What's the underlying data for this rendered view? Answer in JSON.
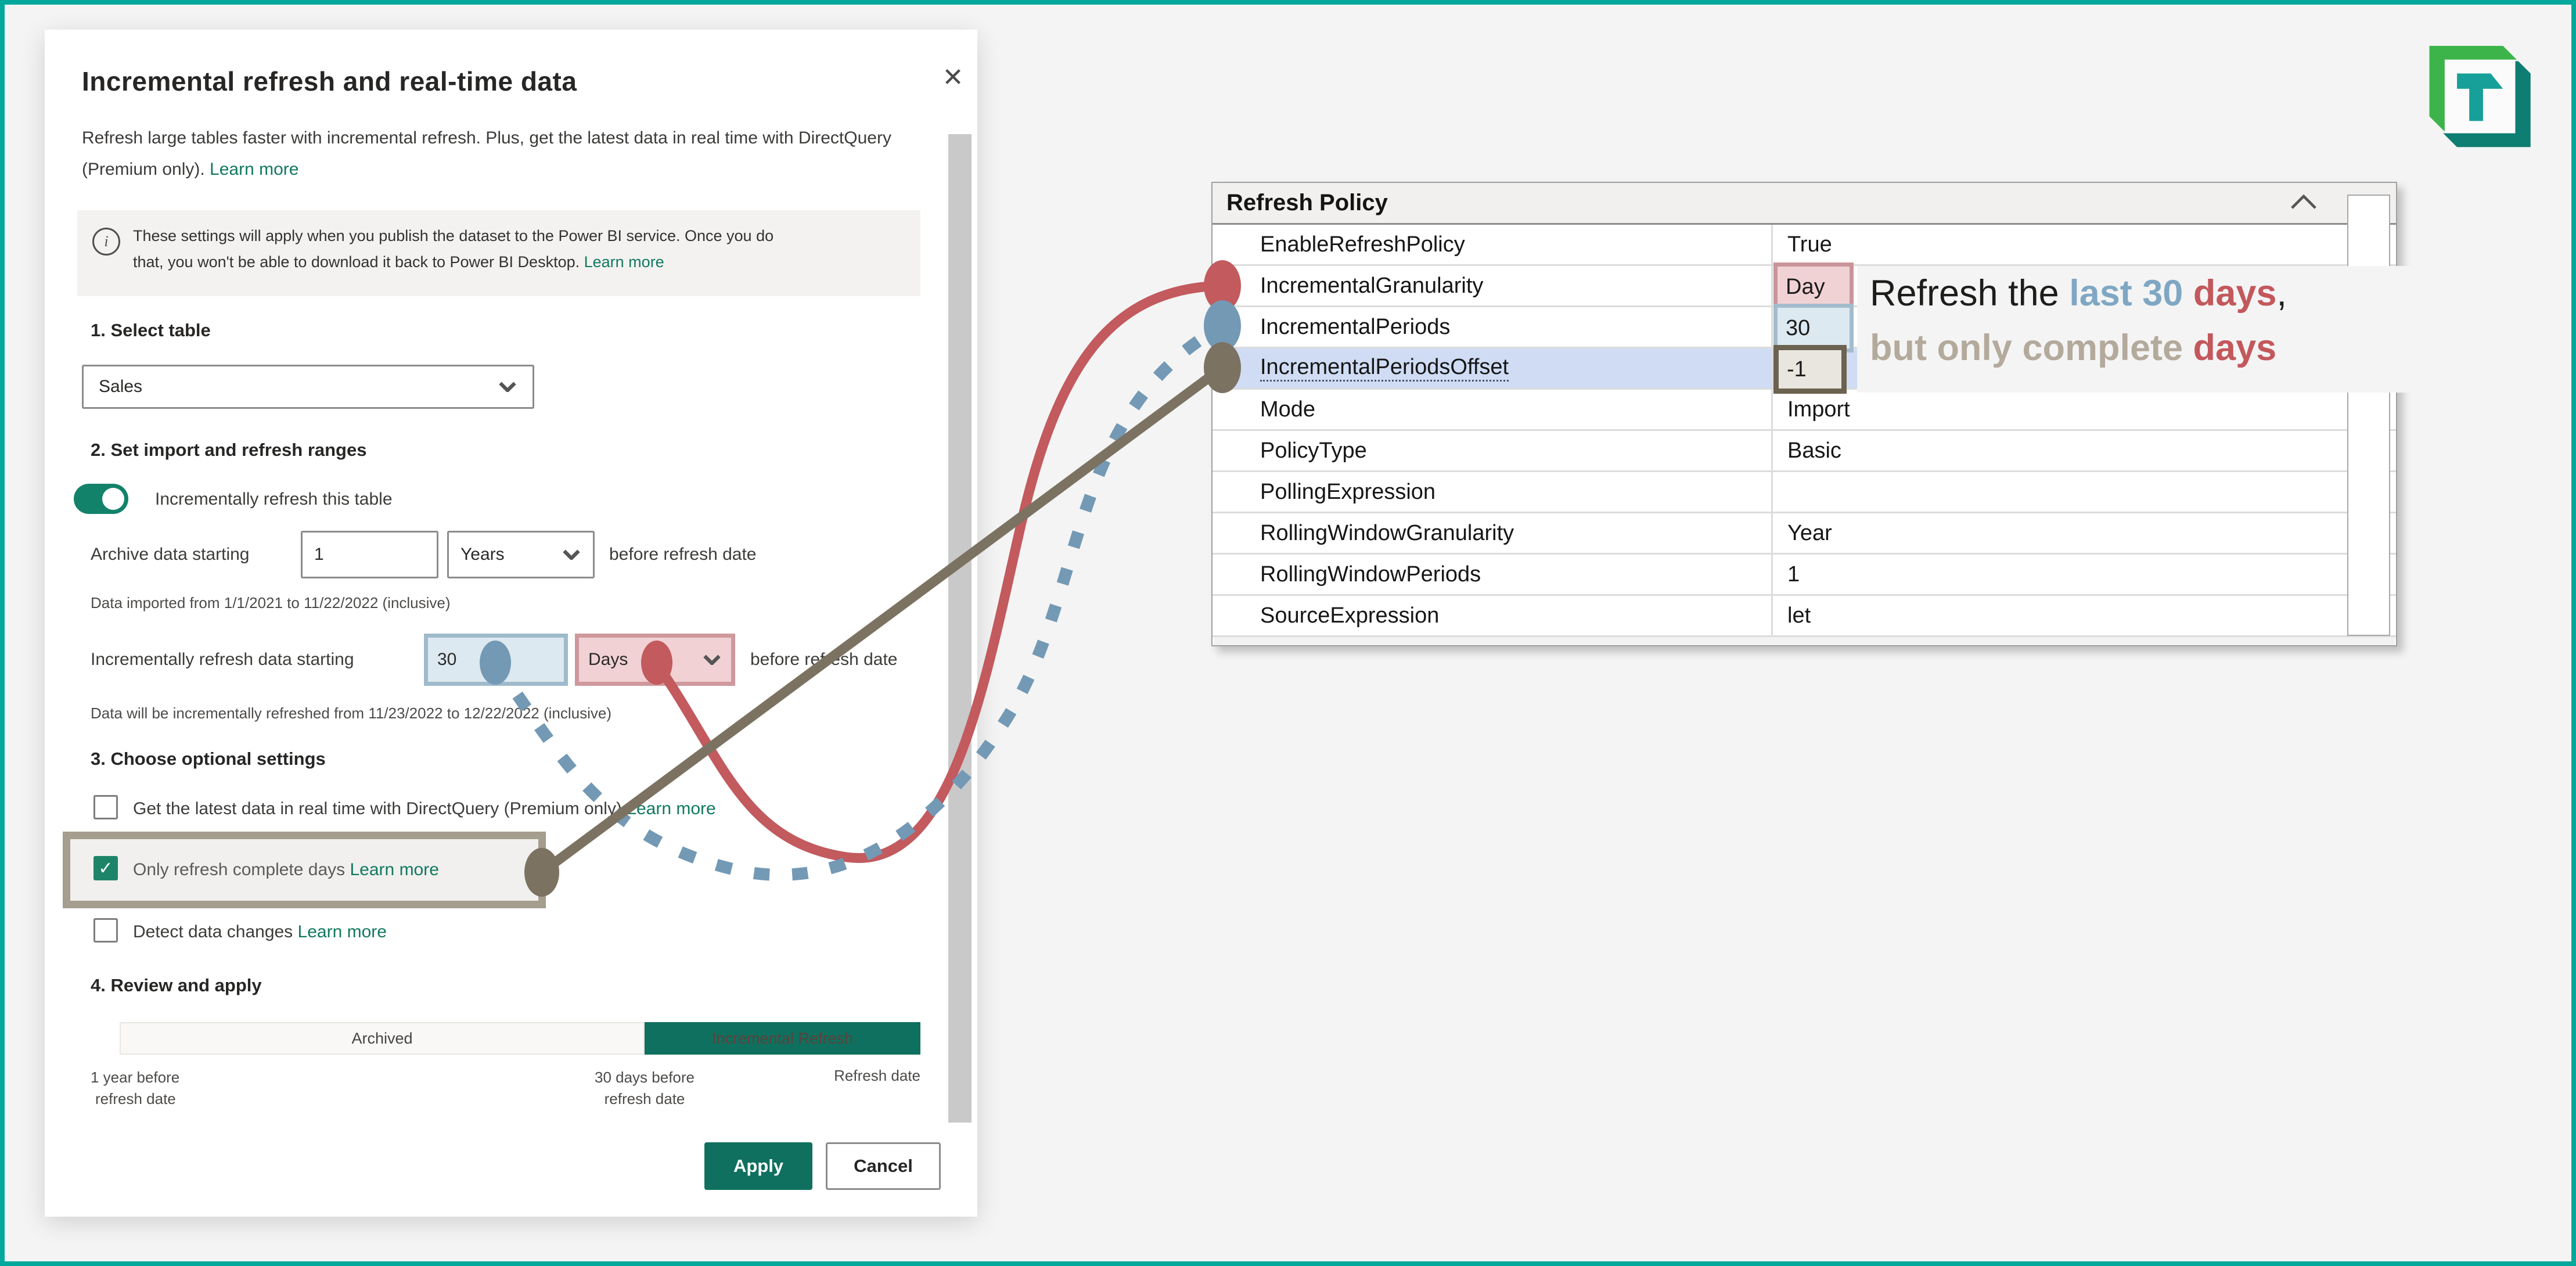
{
  "dialog": {
    "title": "Incremental refresh and real-time data",
    "description": "Refresh large tables faster with incremental refresh. Plus, get the latest data in real time with DirectQuery (Premium only).",
    "description_link": "Learn more",
    "info_line1": "These settings will apply when you publish the dataset to the Power BI service. Once you do",
    "info_line2": "that, you won't be able to download it back to Power BI Desktop.",
    "info_link": "Learn more",
    "info_icon_glyph": "i",
    "section1": "1. Select table",
    "section2": "2. Set import and refresh ranges",
    "section3": "3. Choose optional settings",
    "section4": "4. Review and apply",
    "table_select_value": "Sales",
    "toggle_label": "Incrementally refresh this table",
    "archive_label": "Archive data starting",
    "archive_value": "1",
    "archive_unit": "Years",
    "archive_suffix": "before refresh date",
    "import_note": "Data imported from 1/1/2021 to 11/22/2022 (inclusive)",
    "incremental_label": "Incrementally refresh data starting",
    "incremental_value": "30",
    "incremental_unit": "Days",
    "incremental_suffix": "before refresh date",
    "refresh_note": "Data will be incrementally refreshed from 11/23/2022 to 12/22/2022 (inclusive)",
    "options": [
      {
        "label": "Get the latest data in real time with DirectQuery (Premium only)",
        "link": "Learn more"
      },
      {
        "label": "Only refresh complete days",
        "link": "Learn more"
      },
      {
        "label": "Detect data changes",
        "link": "Learn more"
      }
    ],
    "review": {
      "archived_label": "Archived",
      "incremental_label": "Incremental Refresh",
      "left_line1": "1 year before",
      "left_line2": "refresh date",
      "mid_line1": "30 days before",
      "mid_line2": "refresh date",
      "right_label": "Refresh date"
    },
    "apply_label": "Apply",
    "cancel_label": "Cancel",
    "close_glyph": "✕"
  },
  "property_grid": {
    "title": "Refresh Policy",
    "rows": [
      {
        "name": "EnableRefreshPolicy",
        "value": "True"
      },
      {
        "name": "IncrementalGranularity",
        "value": "Day"
      },
      {
        "name": "IncrementalPeriods",
        "value": "30"
      },
      {
        "name": "IncrementalPeriodsOffset",
        "value": "-1"
      },
      {
        "name": "Mode",
        "value": "Import"
      },
      {
        "name": "PolicyType",
        "value": "Basic"
      },
      {
        "name": "PollingExpression",
        "value": ""
      },
      {
        "name": "RollingWindowGranularity",
        "value": "Year"
      },
      {
        "name": "RollingWindowPeriods",
        "value": "1"
      },
      {
        "name": "SourceExpression",
        "value": "let"
      }
    ]
  },
  "annotation": {
    "seg1": "Refresh the ",
    "seg2": "last 30",
    "seg3": " days",
    "seg4": ",",
    "seg5": "but only complete ",
    "seg6": "days"
  },
  "colors": {
    "frame_teal": "#01a89b",
    "brand_teal": "#10705f",
    "link_teal": "#11795f",
    "accent_red": "#c25a5e",
    "accent_blue": "#7399b5",
    "accent_olive": "#7c7262",
    "annotation_gray": "#b3aa9c",
    "selected_row": "#cfdcf4"
  }
}
